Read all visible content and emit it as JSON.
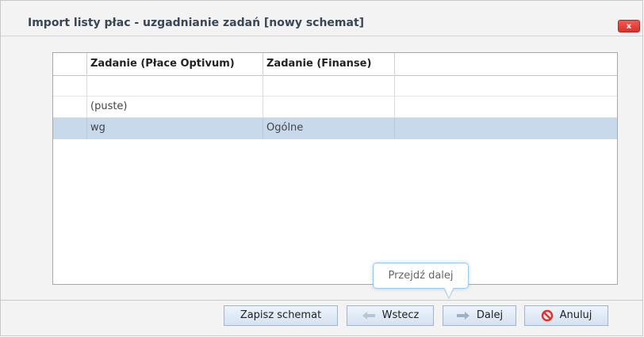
{
  "dialog": {
    "title": "Import listy płac - uzgadnianie zadań [nowy schemat]",
    "close_label": "x"
  },
  "grid": {
    "columns": [
      "",
      "Zadanie (Płace Optivum)",
      "Zadanie (Finanse)",
      ""
    ],
    "rows": [
      {
        "source": "",
        "target": "",
        "selected": false
      },
      {
        "source": "(puste)",
        "target": "",
        "selected": false
      },
      {
        "source": "wg",
        "target": "Ogólne",
        "selected": true
      }
    ]
  },
  "tooltip": {
    "text": "Przejdź dalej"
  },
  "buttons": {
    "save_schema": "Zapisz schemat",
    "back": "Wstecz",
    "next": "Dalej",
    "cancel": "Anuluj"
  },
  "colors": {
    "selected_row": "#c9d9ec",
    "close_button": "#d8322a",
    "tooltip_border": "#9cc9ec"
  }
}
